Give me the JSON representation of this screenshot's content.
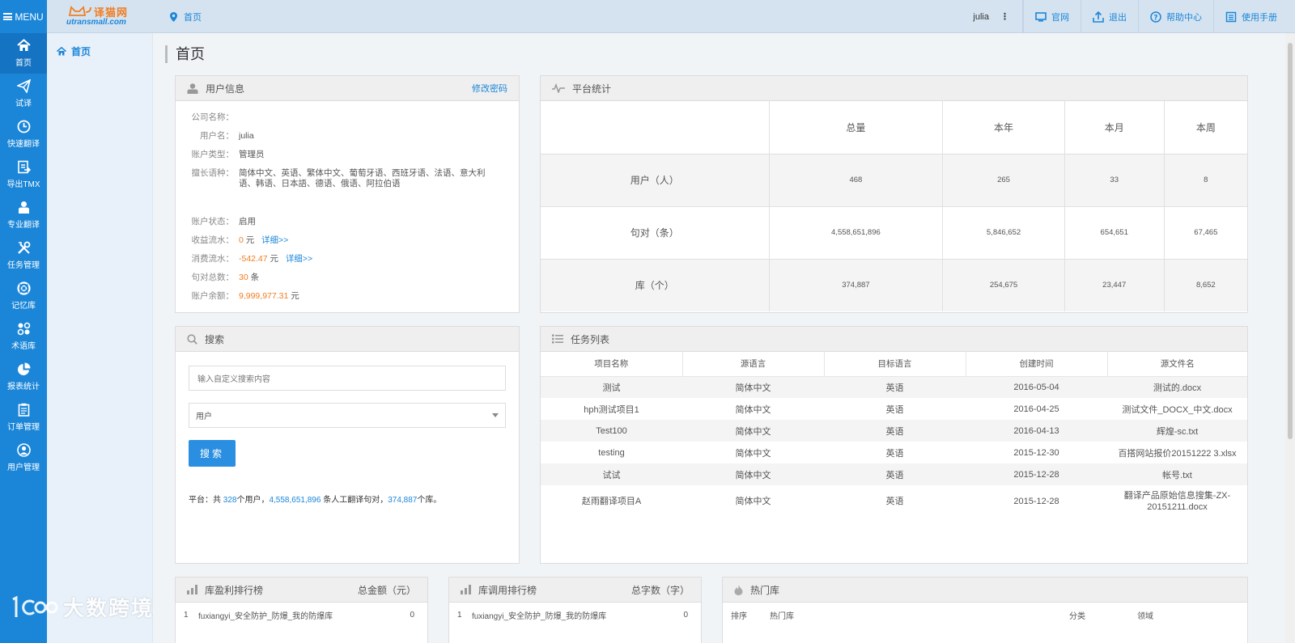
{
  "topbar": {
    "menu_label": "MENU",
    "logo_cn": "译猫网",
    "logo_en": "utransmall.com",
    "breadcrumb": "首页",
    "username": "julia",
    "links": [
      {
        "label": "官网",
        "icon": "monitor-icon"
      },
      {
        "label": "退出",
        "icon": "logout-icon"
      },
      {
        "label": "帮助中心",
        "icon": "help-icon"
      },
      {
        "label": "使用手册",
        "icon": "manual-icon"
      }
    ]
  },
  "sidebar": {
    "items": [
      {
        "label": "首页",
        "icon": "home-icon"
      },
      {
        "label": "试译",
        "icon": "paper-plane-icon"
      },
      {
        "label": "快速翻译",
        "icon": "clock-icon"
      },
      {
        "label": "导出TMX",
        "icon": "export-icon"
      },
      {
        "label": "专业翻译",
        "icon": "translator-icon"
      },
      {
        "label": "任务管理",
        "icon": "tools-icon"
      },
      {
        "label": "记忆库",
        "icon": "lifebuoy-icon"
      },
      {
        "label": "术语库",
        "icon": "dots-icon"
      },
      {
        "label": "报表统计",
        "icon": "pie-chart-icon"
      },
      {
        "label": "订单管理",
        "icon": "clipboard-icon"
      },
      {
        "label": "用户管理",
        "icon": "user-circle-icon"
      }
    ]
  },
  "subnav": {
    "home": "首页"
  },
  "page": {
    "title": "首页"
  },
  "user_info": {
    "title": "用户信息",
    "change_password": "修改密码",
    "company_label": "公司名称：",
    "company": "",
    "username_label": "用户名：",
    "username": "julia",
    "account_type_label": "账户类型：",
    "account_type": "管理员",
    "languages_label": "擅长语种：",
    "languages": "简体中文、英语、繁体中文、葡萄牙语、西班牙语、法语、意大利语、韩语、日本語、德语、俄语、阿拉伯语",
    "status_label": "账户状态：",
    "status": "启用",
    "income_label": "收益流水：",
    "income": "0",
    "income_unit": "元",
    "income_detail": "详细>>",
    "spend_label": "消费流水：",
    "spend": "-542.47",
    "spend_unit": "元",
    "spend_detail": "详细>>",
    "pairs_label": "句对总数：",
    "pairs": "30",
    "pairs_unit": "条",
    "balance_label": "账户余额：",
    "balance": "9,999,977.31",
    "balance_unit": "元"
  },
  "platform_stats": {
    "title": "平台统计",
    "columns": [
      "总量",
      "本年",
      "本月",
      "本周"
    ],
    "rows": [
      {
        "label": "用户（人）",
        "values": [
          "468",
          "265",
          "33",
          "8"
        ]
      },
      {
        "label": "句对（条）",
        "values": [
          "4,558,651,896",
          "5,846,652",
          "654,651",
          "67,465"
        ]
      },
      {
        "label": "库（个）",
        "values": [
          "374,887",
          "254,675",
          "23,447",
          "8,652"
        ]
      }
    ]
  },
  "search": {
    "title": "搜索",
    "placeholder": "输入自定义搜索内容",
    "select_value": "用户",
    "button": "搜索",
    "summary_prefix": "平台：共",
    "summary_users": "328",
    "summary_mid1": "个用户，",
    "summary_pairs": "4,558,651,896",
    "summary_mid2": "条人工翻译句对，",
    "summary_libs": "374,887",
    "summary_suffix": "个库。"
  },
  "task_list": {
    "title": "任务列表",
    "columns": [
      "项目名称",
      "源语言",
      "目标语言",
      "创建时间",
      "源文件名"
    ],
    "rows": [
      [
        "测试",
        "简体中文",
        "英语",
        "2016-05-04",
        "测试的.docx"
      ],
      [
        "hph测试项目1",
        "简体中文",
        "英语",
        "2016-04-25",
        "测试文件_DOCX_中文.docx"
      ],
      [
        "Test100",
        "简体中文",
        "英语",
        "2016-04-13",
        "辉煌-sc.txt"
      ],
      [
        "testing",
        "简体中文",
        "英语",
        "2015-12-30",
        "百搭网站报价20151222 3.xlsx"
      ],
      [
        "试试",
        "简体中文",
        "英语",
        "2015-12-28",
        "帐号.txt"
      ],
      [
        "赵雨翻译项目A",
        "简体中文",
        "英语",
        "2015-12-28",
        "翻译产品原始信息搜集-ZX-20151211.docx"
      ]
    ]
  },
  "profit_rank": {
    "title": "库盈利排行榜",
    "right": "总金额（元）",
    "rows": [
      {
        "rank": "1",
        "name": "fuxiangyi_安全防护_防爆_我的防爆库",
        "value": "0"
      }
    ]
  },
  "usage_rank": {
    "title": "库调用排行榜",
    "right": "总字数（字）",
    "rows": [
      {
        "rank": "1",
        "name": "fuxiangyi_安全防护_防爆_我的防爆库",
        "value": "0"
      }
    ]
  },
  "hot_libs": {
    "title": "热门库",
    "columns": [
      "排序",
      "热门库",
      "分类",
      "领域"
    ]
  },
  "watermark": {
    "text": "大数跨境",
    "logo": "1c00"
  },
  "colors": {
    "accent": "#1b86d8",
    "orange": "#f07d22"
  }
}
